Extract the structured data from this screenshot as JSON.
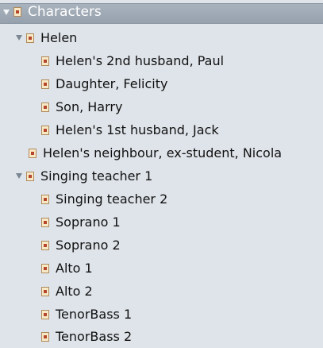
{
  "tree": {
    "root": {
      "label": "Characters",
      "expanded": true
    },
    "items": [
      {
        "label": "Helen",
        "expanded": true
      },
      {
        "label": "Helen's 2nd husband, Paul"
      },
      {
        "label": "Daughter, Felicity"
      },
      {
        "label": "Son, Harry"
      },
      {
        "label": "Helen's 1st husband, Jack"
      },
      {
        "label": "Helen's neighbour, ex-student, Nicola"
      },
      {
        "label": "Singing teacher 1",
        "expanded": true
      },
      {
        "label": "Singing teacher 2"
      },
      {
        "label": "Soprano 1"
      },
      {
        "label": "Soprano 2"
      },
      {
        "label": "Alto 1"
      },
      {
        "label": "Alto 2"
      },
      {
        "label": "TenorBass 1"
      },
      {
        "label": "TenorBass 2"
      }
    ]
  },
  "icons": {
    "disclosure": "disclosure-triangle-icon",
    "document": "document-icon"
  },
  "colors": {
    "background": "#dfe4ea",
    "header": "#9aa5b1"
  }
}
